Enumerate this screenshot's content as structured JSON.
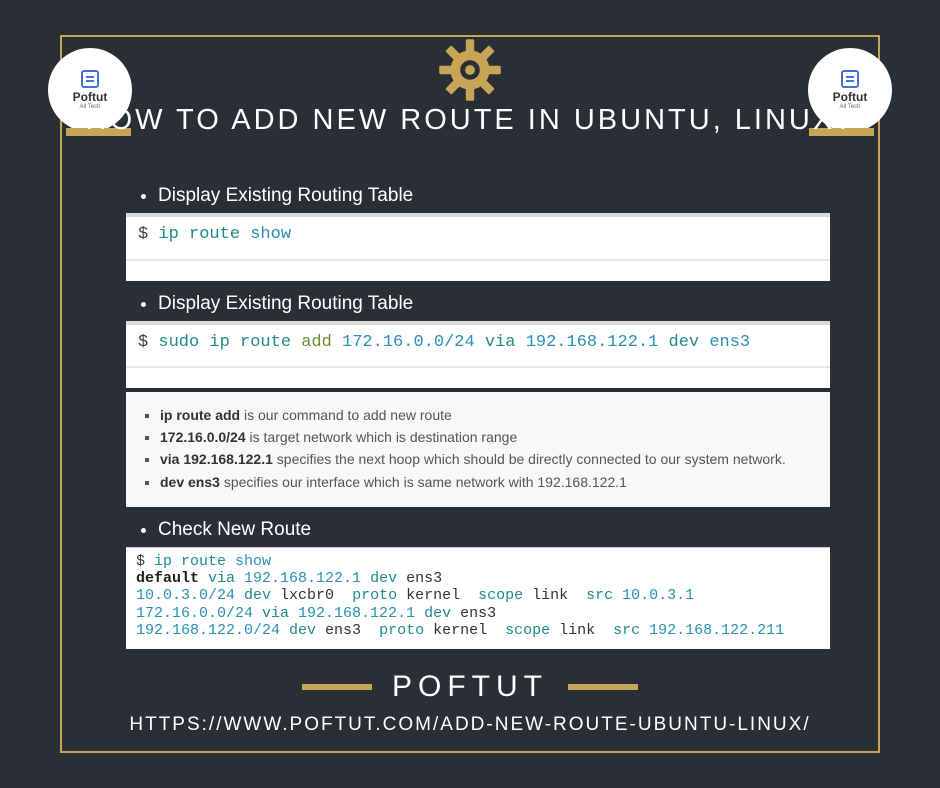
{
  "badge": {
    "name": "Poftut",
    "sub": "All Tech"
  },
  "title": "HOW TO ADD NEW ROUTE IN UBUNTU, LINUX?",
  "sections": {
    "s1": {
      "heading": "Display Existing Routing Table"
    },
    "s2": {
      "heading": "Display Existing Routing Table"
    },
    "s3": {
      "heading": "Check New Route"
    }
  },
  "code1": {
    "prompt": "$ ",
    "cmd": "ip route ",
    "arg": "show"
  },
  "code2": {
    "prompt": "$ ",
    "p1": "sudo ip route ",
    "p2": "add ",
    "p3": "172.16.0.0/24 ",
    "p4": "via ",
    "p5": "192.168.122.1 ",
    "p6": "dev ",
    "p7": "ens3"
  },
  "desc": {
    "d1a": "ip route add",
    "d1b": " is our command to add new route",
    "d2a": "172.16.0.0/24",
    "d2b": " is target network which is destination range",
    "d3a": "via 192.168.122.1",
    "d3b": " specifies the next hoop which should be directly connected to our system network.",
    "d4a": "dev ens3",
    "d4b": " specifies our interface which is same network with 192.168.122.1"
  },
  "code3": {
    "l1a": "$ ",
    "l1b": "ip route ",
    "l1c": "show",
    "l2a": "default",
    "l2b": " via ",
    "l2c": "192.168.122.1 ",
    "l2d": "dev ",
    "l2e": "ens3",
    "l3a": "10.0.3.0/24 ",
    "l3b": "dev ",
    "l3c": "lxcbr0  ",
    "l3d": "proto ",
    "l3e": "kernel  ",
    "l3f": "scope ",
    "l3g": "link  ",
    "l3h": "src ",
    "l3i": "10.0.3.1",
    "l4a": "172.16.0.0/24 ",
    "l4b": "via ",
    "l4c": "192.168.122.1 ",
    "l4d": "dev ",
    "l4e": "ens3",
    "l5a": "192.168.122.0/24 ",
    "l5b": "dev ",
    "l5c": "ens3  ",
    "l5d": "proto ",
    "l5e": "kernel  ",
    "l5f": "scope ",
    "l5g": "link  ",
    "l5h": "src ",
    "l5i": "192.168.122.211"
  },
  "footer": {
    "brand": "POFTUT",
    "url": "HTTPS://WWW.POFTUT.COM/ADD-NEW-ROUTE-UBUNTU-LINUX/"
  }
}
